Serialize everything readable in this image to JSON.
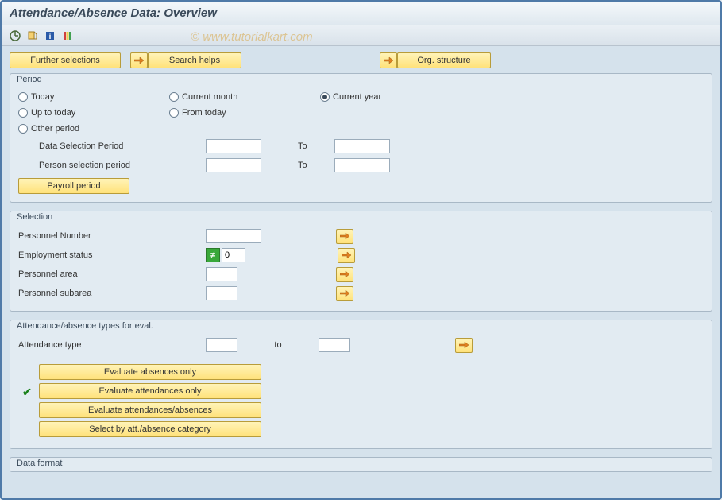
{
  "title": "Attendance/Absence Data: Overview",
  "watermark": "© www.tutorialkart.com",
  "topButtons": {
    "further": "Further selections",
    "search": "Search helps",
    "org": "Org. structure"
  },
  "period": {
    "title": "Period",
    "radios": {
      "today": "Today",
      "currentMonth": "Current month",
      "currentYear": "Current year",
      "upToToday": "Up to today",
      "fromToday": "From today",
      "other": "Other period"
    },
    "selected": "currentYear",
    "dataSelLabel": "Data Selection Period",
    "dataSelFrom": "",
    "dataSelTo": "",
    "personSelLabel": "Person selection period",
    "personSelFrom": "",
    "personSelTo": "",
    "toLabel": "To",
    "payrollBtn": "Payroll period"
  },
  "selection": {
    "title": "Selection",
    "personNoLabel": "Personnel Number",
    "personNoVal": "",
    "empStatusLabel": "Employment status",
    "empStatusVal": "0",
    "persAreaLabel": "Personnel area",
    "persAreaVal": "",
    "persSubLabel": "Personnel subarea",
    "persSubVal": ""
  },
  "attTypes": {
    "title": "Attendance/absence types for eval.",
    "attTypeLabel": "Attendance type",
    "attTypeFrom": "",
    "attTypeTo": "",
    "toLabel": "to",
    "evalAbs": "Evaluate absences only",
    "evalAtt": "Evaluate attendances only",
    "evalBoth": "Evaluate attendances/absences",
    "selectCat": "Select by att./absence category",
    "checkedOption": "evalAtt"
  },
  "dataFormat": {
    "title": "Data format"
  }
}
